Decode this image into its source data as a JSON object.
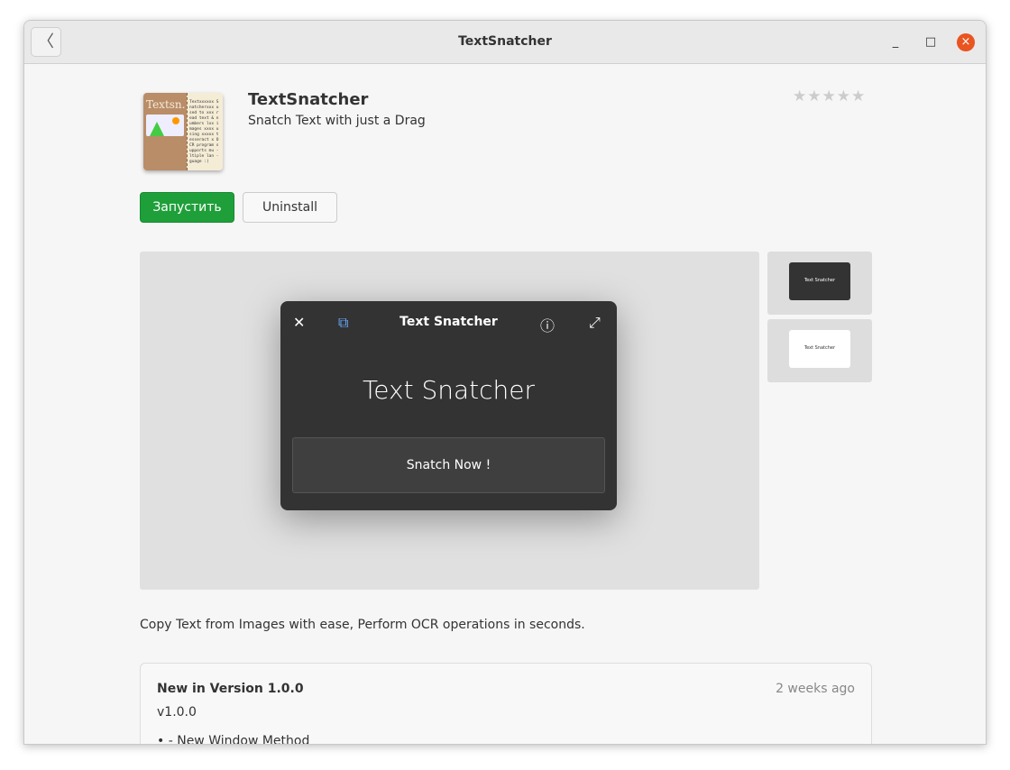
{
  "window": {
    "title": "TextSnatcher",
    "back_icon": "chevron-left",
    "minimize": "_",
    "maximize": "□",
    "close": "×"
  },
  "app": {
    "name": "TextSnatcher",
    "summary": "Snatch Text with just a Drag",
    "rating_stars": "★★★★★",
    "rating": 0,
    "icon_text": {
      "title": "Textsn.",
      "right": "Textxxxxxx Snatcherxxx used to xxx read text & numbers lxx images xxxx using xxxxx tesseract x OCR program supports mu -ltiple lan -guage :)"
    },
    "launch_label": "Запустить",
    "uninstall_label": "Uninstall"
  },
  "screenshot": {
    "title": "Text Snatcher",
    "heading": "Text Snatcher",
    "button": "Snatch Now !"
  },
  "thumbnails": [
    {
      "variant": "dark",
      "label": "Text Snatcher"
    },
    {
      "variant": "light",
      "label": "Text Snatcher"
    }
  ],
  "description": "Copy Text from Images with ease, Perform OCR operations in seconds.",
  "release": {
    "heading": "New in Version 1.0.0",
    "date": "2 weeks ago",
    "version": "v1.0.0",
    "notes": [
      "- New Window Method"
    ]
  }
}
